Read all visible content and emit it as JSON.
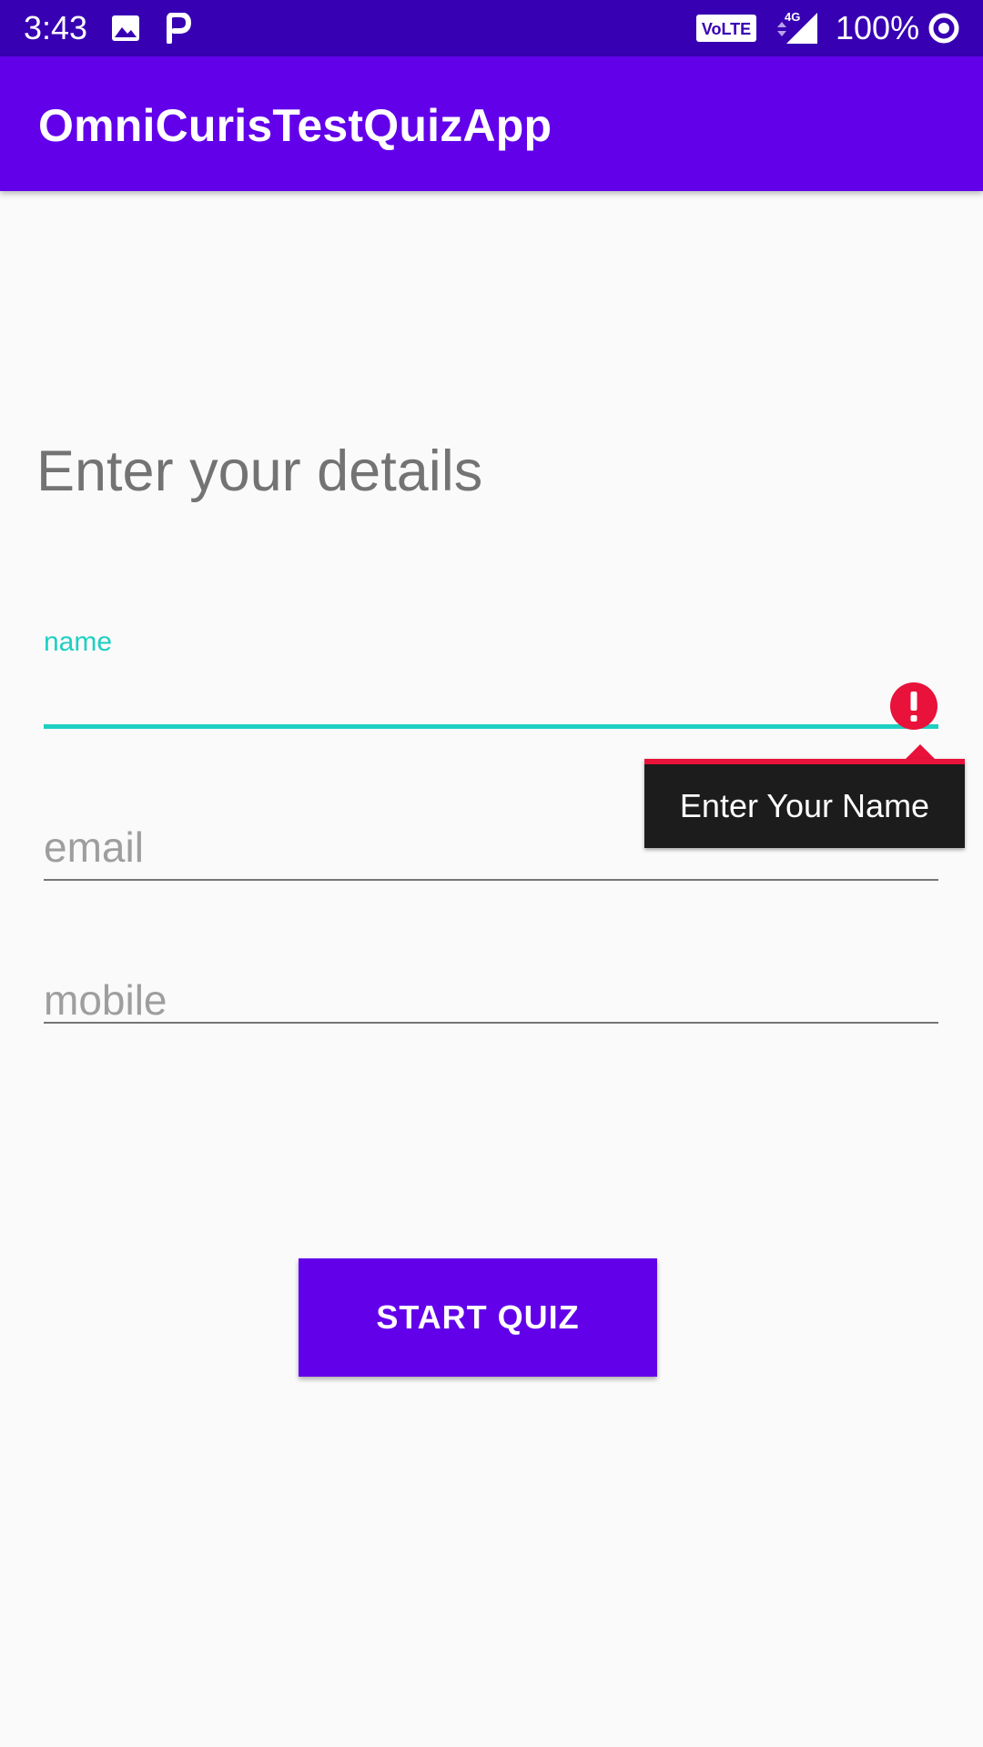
{
  "status_bar": {
    "time": "3:43",
    "icons_left": [
      "image-icon",
      "paytm-p-icon"
    ],
    "icons_right": [
      "volte-icon",
      "4g-signal-icon"
    ],
    "network_label": "4G",
    "volte_label": "VoLTE",
    "battery_text": "100%",
    "battery_icon": "battery-ring-icon"
  },
  "app_bar": {
    "title": "OmniCurisTestQuizApp"
  },
  "form": {
    "heading": "Enter your details",
    "name_field": {
      "floating_label": "name",
      "value": "",
      "error_message": "Enter Your Name"
    },
    "email_field": {
      "placeholder": "email",
      "value": ""
    },
    "mobile_field": {
      "placeholder": "mobile",
      "value": ""
    },
    "submit_label": "START QUIZ"
  },
  "colors": {
    "status_bar": "#3700b3",
    "primary": "#6200ea",
    "accent": "#1fcfc3",
    "error": "#e8123a",
    "background": "#fafafa"
  }
}
